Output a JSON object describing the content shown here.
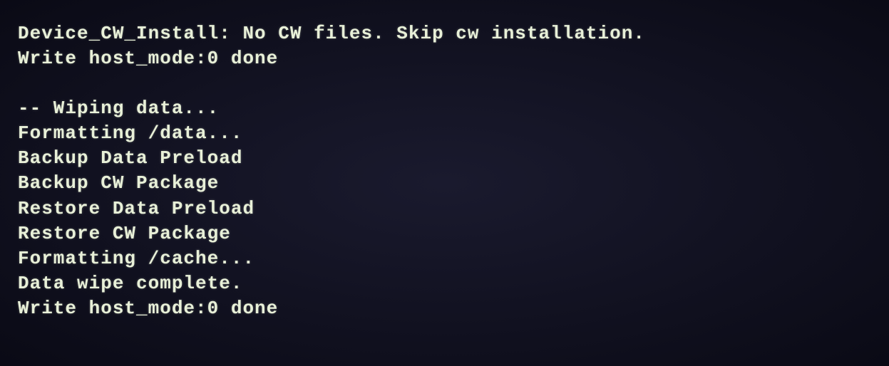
{
  "terminal": {
    "lines": [
      "Device_CW_Install: No CW files. Skip cw installation.",
      "Write host_mode:0 done",
      "",
      "-- Wiping data...",
      "Formatting /data...",
      "Backup Data Preload",
      "Backup CW Package",
      "Restore Data Preload",
      "Restore CW Package",
      "Formatting /cache...",
      "Data wipe complete.",
      "Write host_mode:0 done"
    ]
  }
}
